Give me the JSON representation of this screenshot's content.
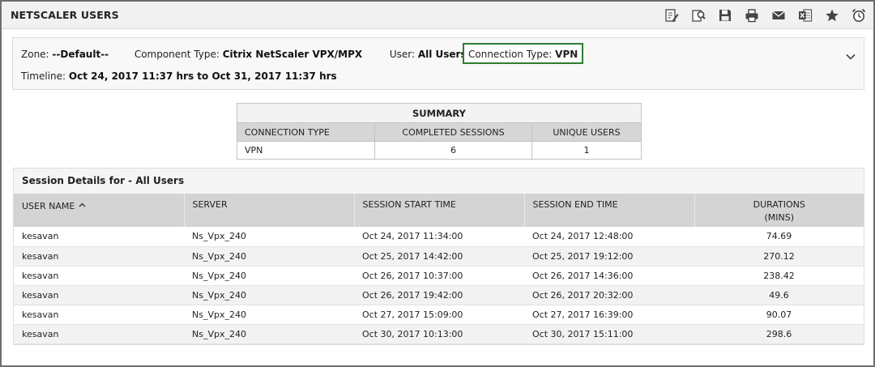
{
  "window": {
    "title": "NETSCALER USERS"
  },
  "toolbar": [
    {
      "name": "edit-report-icon",
      "label": "edit"
    },
    {
      "name": "configure-icon",
      "label": "configure"
    },
    {
      "name": "save-icon",
      "label": "save"
    },
    {
      "name": "print-icon",
      "label": "print"
    },
    {
      "name": "email-icon",
      "label": "email"
    },
    {
      "name": "excel-export-icon",
      "label": "excel"
    },
    {
      "name": "favorite-star-icon",
      "label": "favorite"
    },
    {
      "name": "alarm-clock-icon",
      "label": "schedule"
    }
  ],
  "filters": {
    "zone_label": "Zone:",
    "zone_value": "--Default--",
    "component_label": "Component Type:",
    "component_value": "Citrix NetScaler VPX/MPX",
    "user_label": "User:",
    "user_value": "All Users",
    "connection_label": "Connection Type:",
    "connection_value": "VPN",
    "timeline_label": "Timeline:",
    "timeline_value": "Oct 24, 2017 11:37 hrs to Oct 31, 2017 11:37 hrs"
  },
  "summary": {
    "caption": "SUMMARY",
    "headers": [
      "CONNECTION TYPE",
      "COMPLETED SESSIONS",
      "UNIQUE USERS"
    ],
    "row": [
      "VPN",
      "6",
      "1"
    ]
  },
  "details": {
    "title": "Session Details for - All Users",
    "headers": [
      "USER NAME",
      "SERVER",
      "SESSION START TIME",
      "SESSION END TIME",
      "DURATIONS",
      "(MINS)"
    ],
    "rows": [
      [
        "kesavan",
        "Ns_Vpx_240",
        "Oct 24, 2017 11:34:00",
        "Oct 24, 2017 12:48:00",
        "74.69"
      ],
      [
        "kesavan",
        "Ns_Vpx_240",
        "Oct 25, 2017 14:42:00",
        "Oct 25, 2017 19:12:00",
        "270.12"
      ],
      [
        "kesavan",
        "Ns_Vpx_240",
        "Oct 26, 2017 10:37:00",
        "Oct 26, 2017 14:36:00",
        "238.42"
      ],
      [
        "kesavan",
        "Ns_Vpx_240",
        "Oct 26, 2017 19:42:00",
        "Oct 26, 2017 20:32:00",
        "49.6"
      ],
      [
        "kesavan",
        "Ns_Vpx_240",
        "Oct 27, 2017 15:09:00",
        "Oct 27, 2017 16:39:00",
        "90.07"
      ],
      [
        "kesavan",
        "Ns_Vpx_240",
        "Oct 30, 2017 10:13:00",
        "Oct 30, 2017 15:11:00",
        "298.6"
      ]
    ]
  },
  "colors": {
    "accent_border": "#2e7d32",
    "header_gray": "#d4d4d4"
  }
}
